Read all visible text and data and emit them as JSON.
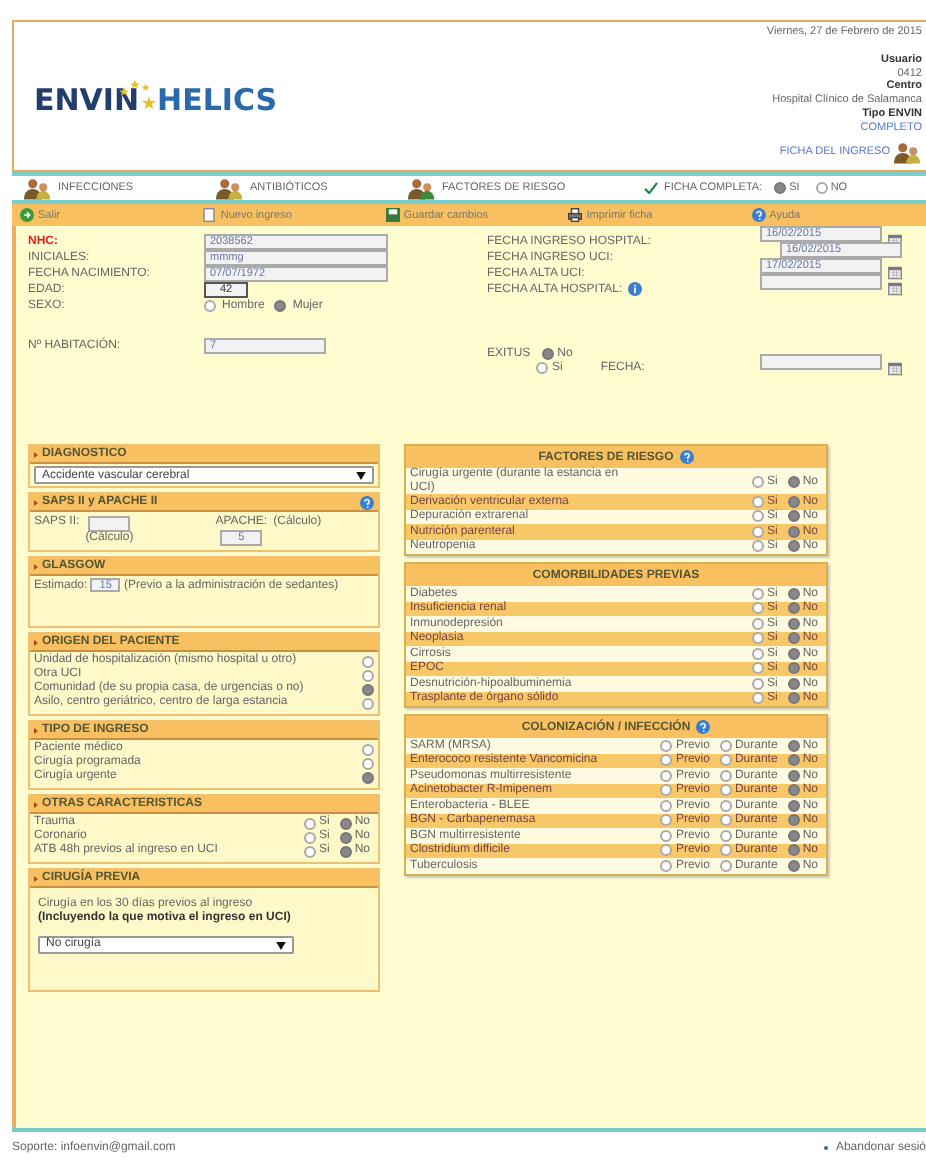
{
  "header": {
    "date": "Viernes, 27 de Febrero de 2015",
    "user_label": "Usuario",
    "user_value": "0412",
    "center_label": "Centro",
    "center_value": "Hospital Clínico de Salamanca",
    "type_label": "Tipo ENVIN",
    "type_value": "COMPLETO",
    "record_link": "FICHA DEL INGRESO"
  },
  "logo": {
    "left": "ENVIN",
    "right": "HELICS"
  },
  "nav": {
    "items": [
      {
        "label": "INFECCIONES"
      },
      {
        "label": "ANTIBIÓTICOS"
      },
      {
        "label": "FACTORES DE RIESGO"
      }
    ],
    "complete": {
      "label": "FICHA COMPLETA:",
      "options": [
        {
          "label": "SI",
          "selected": true
        },
        {
          "label": "NO",
          "selected": false
        }
      ]
    }
  },
  "toolbar": [
    {
      "label": "Salir",
      "kind": "exit"
    },
    {
      "label": "Nuevo ingreso",
      "kind": "new"
    },
    {
      "label": "Guardar cambios",
      "kind": "save"
    },
    {
      "label": "Imprimir ficha",
      "kind": "print"
    },
    {
      "label": "Ayuda",
      "kind": "help"
    }
  ],
  "patient": {
    "left": [
      {
        "label": "NHC:",
        "value": "2038562",
        "required": true,
        "kind": "wide"
      },
      {
        "label": "INICIALES:",
        "value": "mmmg",
        "required": false,
        "kind": "wide"
      },
      {
        "label": "FECHA NACIMIENTO:",
        "value": "07/07/1972",
        "required": false,
        "kind": "wide"
      },
      {
        "label": "EDAD:",
        "value": "42",
        "required": false,
        "kind": "short"
      }
    ],
    "sex": {
      "label": "SEXO:",
      "options": [
        {
          "label": "Hombre",
          "selected": false
        },
        {
          "label": "Mujer",
          "selected": true
        }
      ]
    },
    "room": {
      "label": "Nº HABITACIÓN:",
      "value": "7"
    },
    "right": [
      {
        "label": "FECHA INGRESO HOSPITAL:",
        "value": "16/02/2015",
        "calendar": true,
        "info": false
      },
      {
        "label": "FECHA INGRESO UCI:",
        "value": "16/02/2015",
        "calendar": false,
        "info": false
      },
      {
        "label": "FECHA ALTA UCI:",
        "value": "17/02/2015",
        "calendar": true,
        "info": false
      },
      {
        "label": "FECHA ALTA HOSPITAL:",
        "calendar": true,
        "info": true
      }
    ],
    "exitus": {
      "label": "EXITUS",
      "options": [
        {
          "label": "No",
          "selected": true
        },
        {
          "label": "Si",
          "selected": false
        }
      ],
      "date_label": "FECHA:"
    }
  },
  "left_sections": [
    {
      "kind": "select",
      "title": "DIAGNOSTICO",
      "help": false,
      "value": "Accidente vascular cerebral"
    },
    {
      "kind": "scores",
      "title": "SAPS II y APACHE II",
      "help": true,
      "saps_label": "SAPS II:",
      "saps_hint": "(Cálculo)",
      "apache_label": "APACHE:",
      "apache_value": "5",
      "apache_hint": "(Cálculo)"
    },
    {
      "kind": "glasgow",
      "title": "GLASGOW",
      "help": false,
      "label": "Estimado:",
      "value": "15",
      "note": "(Previo a la administración de sedantes)"
    },
    {
      "kind": "choice",
      "title": "ORIGEN DEL PACIENTE",
      "help": false,
      "options": [
        {
          "label": "Unidad de hospitalización (mismo hospital u otro)",
          "selected": false
        },
        {
          "label": "Otra UCI",
          "selected": false
        },
        {
          "label": "Comunidad (de su propia casa, de urgencias o no)",
          "selected": true
        },
        {
          "label": "Asilo, centro geriátrico, centro de larga estancia",
          "selected": false
        }
      ]
    },
    {
      "kind": "choice",
      "title": "TIPO DE INGRESO",
      "help": false,
      "options": [
        {
          "label": "Paciente médico",
          "selected": false
        },
        {
          "label": "Cirugía programada",
          "selected": false
        },
        {
          "label": "Cirugía urgente",
          "selected": true
        }
      ]
    },
    {
      "kind": "yesno",
      "title": "OTRAS CARACTERISTICAS",
      "help": false,
      "rows": [
        {
          "label": "Trauma",
          "options": [
            {
              "label": "Si",
              "selected": false
            },
            {
              "label": "No",
              "selected": true
            }
          ]
        },
        {
          "label": "Coronario",
          "options": [
            {
              "label": "Si",
              "selected": false
            },
            {
              "label": "No",
              "selected": true
            }
          ]
        },
        {
          "label": "ATB 48h previos al ingreso en UCI",
          "options": [
            {
              "label": "Si",
              "selected": false
            },
            {
              "label": "No",
              "selected": true
            }
          ]
        }
      ]
    },
    {
      "kind": "surgery",
      "title": "CIRUGÍA PREVIA",
      "help": false,
      "text": "Cirugía en los 30 días previos al ingreso",
      "note": "(Incluyendo la que motiva el ingreso en UCI)",
      "value": "No cirugía"
    }
  ],
  "right_panels": [
    {
      "title": "FACTORES DE RIESGO",
      "help": true,
      "rows": [
        {
          "label": "Cirugía urgente (durante la estancia en UCI)",
          "options": [
            {
              "label": "Si",
              "selected": false
            },
            {
              "label": "No",
              "selected": true
            }
          ]
        },
        {
          "label": "Derivación ventricular externa",
          "options": [
            {
              "label": "Si",
              "selected": false
            },
            {
              "label": "No",
              "selected": true
            }
          ]
        },
        {
          "label": "Depuración extrarenal",
          "options": [
            {
              "label": "Si",
              "selected": false
            },
            {
              "label": "No",
              "selected": true
            }
          ]
        },
        {
          "label": "Nutrición parenteral",
          "options": [
            {
              "label": "Si",
              "selected": false
            },
            {
              "label": "No",
              "selected": true
            }
          ]
        },
        {
          "label": "Neutropenia",
          "options": [
            {
              "label": "Si",
              "selected": false
            },
            {
              "label": "No",
              "selected": true
            }
          ]
        }
      ]
    },
    {
      "title": "COMORBILIDADES PREVIAS",
      "help": false,
      "rows": [
        {
          "label": "Diabetes",
          "options": [
            {
              "label": "Si",
              "selected": false
            },
            {
              "label": "No",
              "selected": true
            }
          ]
        },
        {
          "label": "Insuficiencia renal",
          "options": [
            {
              "label": "Si",
              "selected": false
            },
            {
              "label": "No",
              "selected": true
            }
          ]
        },
        {
          "label": "Inmunodepresión",
          "options": [
            {
              "label": "Si",
              "selected": false
            },
            {
              "label": "No",
              "selected": true
            }
          ]
        },
        {
          "label": "Neoplasia",
          "options": [
            {
              "label": "Si",
              "selected": false
            },
            {
              "label": "No",
              "selected": true
            }
          ]
        },
        {
          "label": "Cirrosis",
          "options": [
            {
              "label": "Si",
              "selected": false
            },
            {
              "label": "No",
              "selected": true
            }
          ]
        },
        {
          "label": "EPOC",
          "options": [
            {
              "label": "Si",
              "selected": false
            },
            {
              "label": "No",
              "selected": true
            }
          ]
        },
        {
          "label": "Desnutrición-hipoalbuminemia",
          "options": [
            {
              "label": "Si",
              "selected": false
            },
            {
              "label": "No",
              "selected": true
            }
          ]
        },
        {
          "label": "Trasplante de órgano sólido",
          "options": [
            {
              "label": "Si",
              "selected": false
            },
            {
              "label": "No",
              "selected": true
            }
          ]
        }
      ]
    },
    {
      "title": "COLONIZACIÓN / INFECCIÓN",
      "help": true,
      "rows": [
        {
          "label": "SARM (MRSA)",
          "options": [
            {
              "label": "Previo",
              "selected": false
            },
            {
              "label": "Durante",
              "selected": false
            },
            {
              "label": "No",
              "selected": true
            }
          ]
        },
        {
          "label": "Enterococo resistente Vancomicina",
          "options": [
            {
              "label": "Previo",
              "selected": false
            },
            {
              "label": "Durante",
              "selected": false
            },
            {
              "label": "No",
              "selected": true
            }
          ]
        },
        {
          "label": "Pseudomonas multirresistente",
          "options": [
            {
              "label": "Previo",
              "selected": false
            },
            {
              "label": "Durante",
              "selected": false
            },
            {
              "label": "No",
              "selected": true
            }
          ]
        },
        {
          "label": "Acinetobacter R-Imipenem",
          "options": [
            {
              "label": "Previo",
              "selected": false
            },
            {
              "label": "Durante",
              "selected": false
            },
            {
              "label": "No",
              "selected": true
            }
          ]
        },
        {
          "label": "Enterobacteria - BLEE",
          "options": [
            {
              "label": "Previo",
              "selected": false
            },
            {
              "label": "Durante",
              "selected": false
            },
            {
              "label": "No",
              "selected": true
            }
          ]
        },
        {
          "label": "BGN - Carbapenemasa",
          "options": [
            {
              "label": "Previo",
              "selected": false
            },
            {
              "label": "Durante",
              "selected": false
            },
            {
              "label": "No",
              "selected": true
            }
          ]
        },
        {
          "label": "BGN multirresistente",
          "options": [
            {
              "label": "Previo",
              "selected": false
            },
            {
              "label": "Durante",
              "selected": false
            },
            {
              "label": "No",
              "selected": true
            }
          ]
        },
        {
          "label": "Clostridium difficile",
          "options": [
            {
              "label": "Previo",
              "selected": false
            },
            {
              "label": "Durante",
              "selected": false
            },
            {
              "label": "No",
              "selected": true
            }
          ]
        },
        {
          "label": "Tuberculosis",
          "options": [
            {
              "label": "Previo",
              "selected": false
            },
            {
              "label": "Durante",
              "selected": false
            },
            {
              "label": "No",
              "selected": true
            }
          ]
        }
      ]
    }
  ],
  "footer": {
    "support": "Soporte: infoenvin@gmail.com",
    "logout": "Abandonar sesió"
  }
}
